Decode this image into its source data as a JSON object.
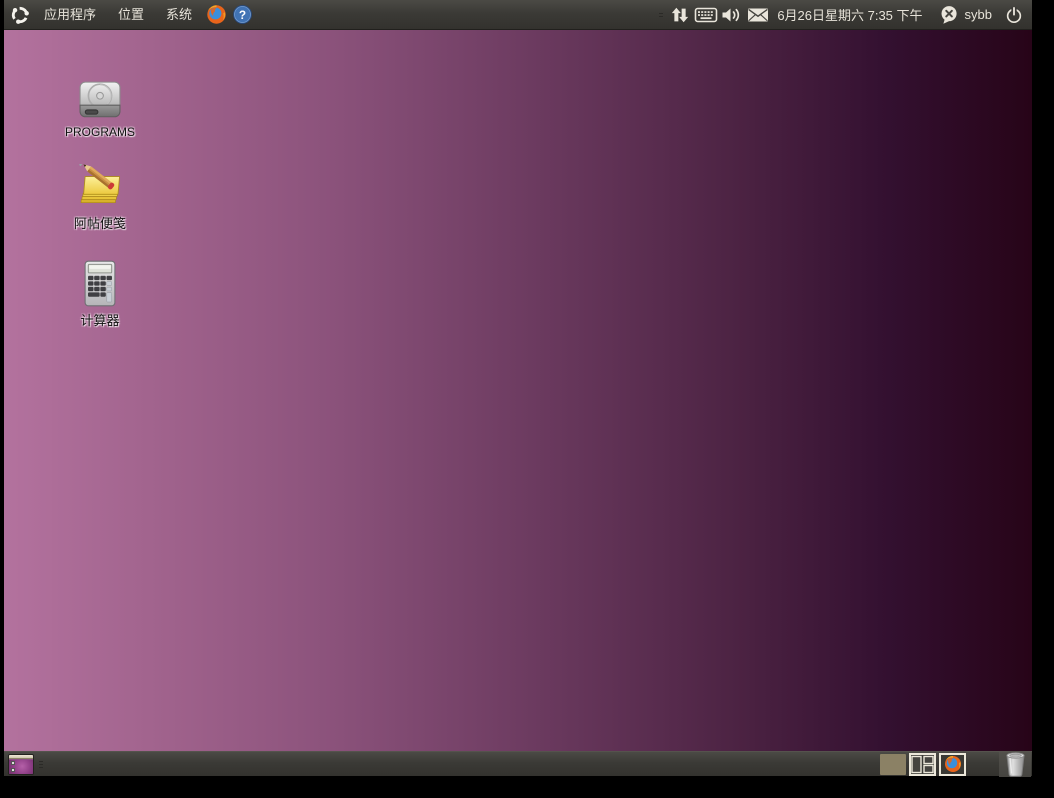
{
  "colors": {
    "panel_bg": "#3b3a36",
    "panel_text": "#e7e3d9",
    "desktop_gradient_left": "#b3729e",
    "desktop_gradient_right": "#270418",
    "workspace_active_bg": "#8b8165",
    "workspace_border": "#ece8da",
    "desktop_label_text": "#111111"
  },
  "top_panel": {
    "logo_icon": "ubuntu-logo",
    "menus": [
      {
        "label": "应用程序"
      },
      {
        "label": "位置"
      },
      {
        "label": "系统"
      }
    ],
    "launchers": [
      {
        "name": "firefox-launcher"
      },
      {
        "name": "help-launcher"
      }
    ],
    "indicators": [
      {
        "name": "network-traffic"
      },
      {
        "name": "keyboard-layout"
      },
      {
        "name": "volume"
      },
      {
        "name": "messages"
      }
    ],
    "clock": "6月26日星期六  7:35 下午",
    "me_menu": {
      "username": "sybb",
      "status": "offline"
    }
  },
  "desktop": {
    "icons": [
      {
        "label": "PROGRAMS",
        "icon": "hard-disk"
      },
      {
        "label": "阿帖便笺",
        "icon": "sticky-notes"
      },
      {
        "label": "计算器",
        "icon": "calculator"
      }
    ]
  },
  "bottom_panel": {
    "show_desktop": {
      "name": "show-desktop"
    },
    "workspaces": [
      {
        "name": "workspace-1",
        "state": "active",
        "content": "empty"
      },
      {
        "name": "workspace-2",
        "state": "inactive",
        "content": "windows"
      },
      {
        "name": "workspace-3",
        "state": "inactive",
        "content": "firefox"
      }
    ],
    "trash": {
      "name": "trash",
      "state": "empty"
    }
  }
}
